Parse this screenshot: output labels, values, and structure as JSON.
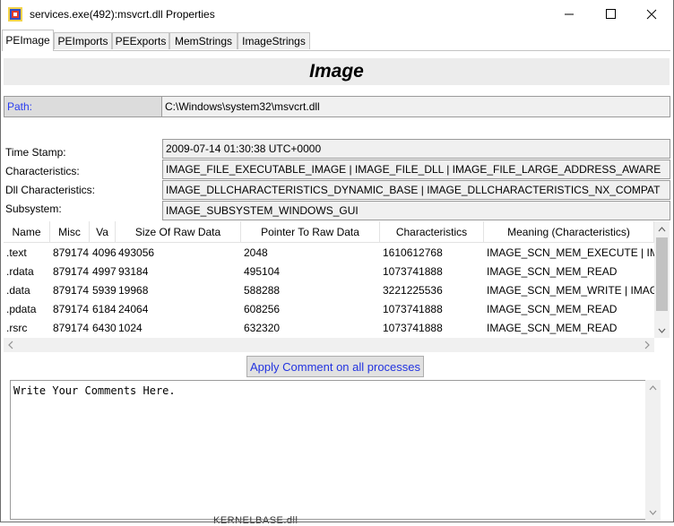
{
  "window": {
    "title": "services.exe(492):msvcrt.dll Properties",
    "icons": {
      "app": "process-explorer-icon",
      "minimize": "minimize-icon",
      "maximize": "maximize-icon",
      "close": "close-icon"
    }
  },
  "tabs": [
    {
      "label": "PEImage",
      "active": true
    },
    {
      "label": "PEImports",
      "active": false
    },
    {
      "label": "PEExports",
      "active": false
    },
    {
      "label": "MemStrings",
      "active": false
    },
    {
      "label": "ImageStrings",
      "active": false
    }
  ],
  "header": {
    "title": "Image"
  },
  "path": {
    "label": "Path:",
    "value": "C:\\Windows\\system32\\msvcrt.dll"
  },
  "properties": [
    {
      "label": "Time Stamp:",
      "value": "2009-07-14 01:30:38 UTC+0000"
    },
    {
      "label": "Characteristics:",
      "value": "IMAGE_FILE_EXECUTABLE_IMAGE | IMAGE_FILE_DLL | IMAGE_FILE_LARGE_ADDRESS_AWARE"
    },
    {
      "label": "Dll Characteristics:",
      "value": "IMAGE_DLLCHARACTERISTICS_DYNAMIC_BASE | IMAGE_DLLCHARACTERISTICS_NX_COMPAT"
    },
    {
      "label": "Subsystem:",
      "value": "IMAGE_SUBSYSTEM_WINDOWS_GUI"
    }
  ],
  "sections_table": {
    "columns": [
      "Name",
      "Misc",
      "Va",
      "Size Of Raw Data",
      "Pointer To Raw Data",
      "Characteristics",
      "Meaning (Characteristics)"
    ],
    "rows": [
      [
        ".text",
        "879174",
        "4096",
        "493056",
        "2048",
        "1610612768",
        "IMAGE_SCN_MEM_EXECUTE | IMAGE_SCN_MEM_READ"
      ],
      [
        ".rdata",
        "879174",
        "4997",
        "93184",
        "495104",
        "1073741888",
        "IMAGE_SCN_MEM_READ"
      ],
      [
        ".data",
        "879174",
        "5939",
        "19968",
        "588288",
        "3221225536",
        "IMAGE_SCN_MEM_WRITE | IMAGE_SCN_MEM_READ"
      ],
      [
        ".pdata",
        "879174",
        "6184",
        "24064",
        "608256",
        "1073741888",
        "IMAGE_SCN_MEM_READ"
      ],
      [
        ".rsrc",
        "879174",
        "6430",
        "1024",
        "632320",
        "1073741888",
        "IMAGE_SCN_MEM_READ"
      ]
    ]
  },
  "apply_button": {
    "label": "Apply Comment on all processes"
  },
  "comment": {
    "value": "Write Your Comments Here."
  },
  "background_text": "KERNELBASE.dll"
}
